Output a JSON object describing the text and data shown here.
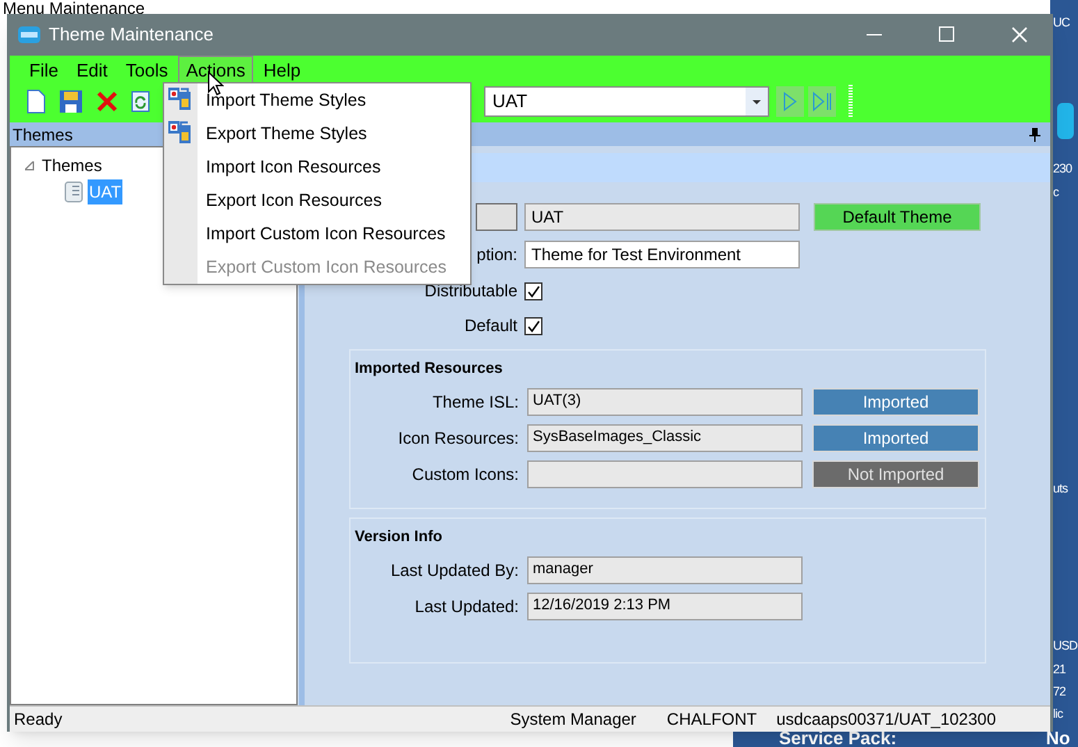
{
  "background": {
    "heading": "Menu Maintenance",
    "side_texts": [
      "UC",
      "230",
      "c",
      "uts",
      "USD",
      "21",
      "72",
      "lic"
    ],
    "service_pack_label": "Service Pack:",
    "service_pack_value": "No"
  },
  "window": {
    "title": "Theme Maintenance"
  },
  "menu_bar": [
    {
      "label": "File",
      "selected": false
    },
    {
      "label": "Edit",
      "selected": false
    },
    {
      "label": "Tools",
      "selected": false
    },
    {
      "label": "Actions",
      "selected": true
    },
    {
      "label": "Help",
      "selected": false
    }
  ],
  "actions_menu": [
    {
      "label": "Import Theme Styles",
      "kind": "icon",
      "disabled": false
    },
    {
      "label": "Export Theme Styles",
      "kind": "icon",
      "disabled": false
    },
    {
      "label": "Import Icon Resources",
      "kind": "plain",
      "disabled": false
    },
    {
      "label": "Export Icon Resources",
      "kind": "plain",
      "disabled": false
    },
    {
      "label": "Import Custom Icon Resources",
      "kind": "plain",
      "disabled": false
    },
    {
      "label": "Export Custom Icon Resources",
      "kind": "plain",
      "disabled": true
    }
  ],
  "toolbar": {
    "theme_select": "UAT"
  },
  "themes_panel": {
    "title": "Themes",
    "tree": [
      {
        "label": "Themes",
        "expanded": true,
        "children": [
          {
            "label": "UAT",
            "selected": true
          }
        ]
      }
    ]
  },
  "form": {
    "name_value": "UAT",
    "default_badge": "Default Theme",
    "description_label": "ption:",
    "description_value": "Theme for Test Environment",
    "checks": [
      {
        "label": "Distributable",
        "checked": true
      },
      {
        "label": "Default",
        "checked": true
      }
    ],
    "imported_resources": {
      "title": "Imported Resources",
      "rows": [
        {
          "label": "Theme ISL:",
          "value": "UAT(3)",
          "status": "Imported",
          "imported": true
        },
        {
          "label": "Icon Resources:",
          "value": "SysBaseImages_Classic",
          "status": "Imported",
          "imported": true
        },
        {
          "label": "Custom Icons:",
          "value": "",
          "status": "Not Imported",
          "imported": false
        }
      ]
    },
    "version_info": {
      "title": "Version Info",
      "rows": [
        {
          "label": "Last Updated By:",
          "value": "manager"
        },
        {
          "label": "Last Updated:",
          "value": "12/16/2019 2:13 PM"
        }
      ]
    }
  },
  "status_bar": [
    "Ready",
    "System Manager",
    "CHALFONT",
    "usdcaaps00371/UAT_102300"
  ]
}
